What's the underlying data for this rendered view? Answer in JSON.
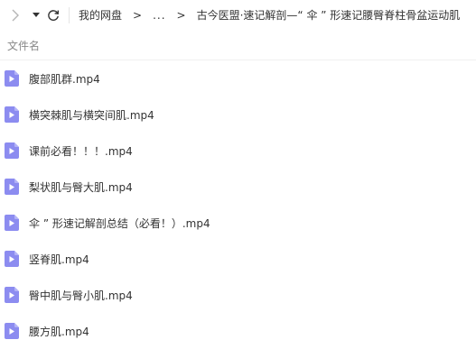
{
  "toolbar": {
    "icons": [
      "chevron-right-icon",
      "caret-down-icon",
      "refresh-icon"
    ],
    "breadcrumb": [
      {
        "label": "我的网盘"
      },
      {
        "label": "..."
      },
      {
        "label": "古今医盟·速记解剖—“ 伞 ” 形速记腰臀脊柱骨盆运动肌"
      }
    ],
    "separator": ">"
  },
  "list_header": {
    "name_label": "文件名"
  },
  "files": [
    {
      "name": "腹部肌群.mp4",
      "icon": "video-file-icon"
    },
    {
      "name": "横突棘肌与横突间肌.mp4",
      "icon": "video-file-icon"
    },
    {
      "name": "课前必看！！！.mp4",
      "icon": "video-file-icon"
    },
    {
      "name": "梨状肌与臀大肌.mp4",
      "icon": "video-file-icon"
    },
    {
      "name": "伞 ” 形速记解剖总结（必看！）.mp4",
      "icon": "video-file-icon"
    },
    {
      "name": "竖脊肌.mp4",
      "icon": "video-file-icon"
    },
    {
      "name": "臀中肌与臀小肌.mp4",
      "icon": "video-file-icon"
    },
    {
      "name": "腰方肌.mp4",
      "icon": "video-file-icon"
    }
  ],
  "colors": {
    "icon_fill": "#8c8cf0",
    "icon_fold": "#b3b3f7",
    "text": "#333333",
    "header_text": "#888888"
  }
}
